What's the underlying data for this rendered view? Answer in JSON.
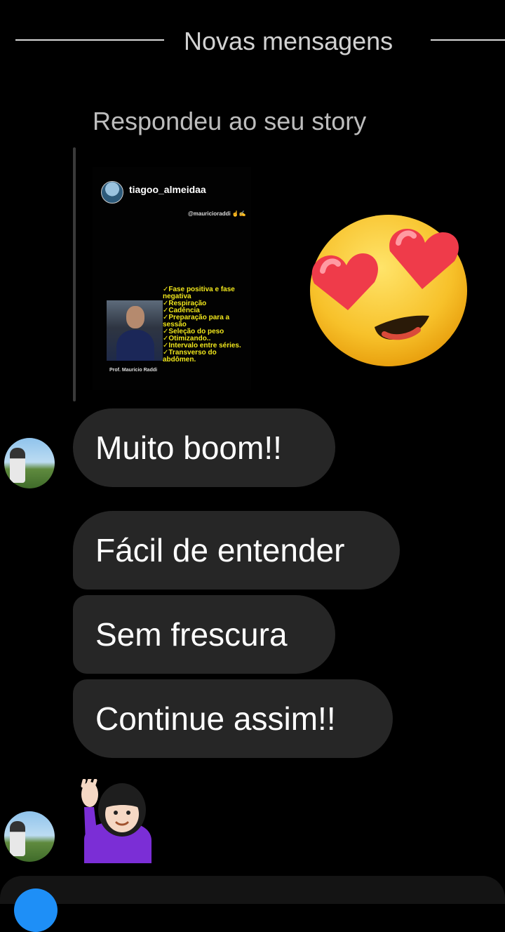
{
  "divider": {
    "label": "Novas mensagens"
  },
  "reply": {
    "note": "Respondeu ao seu story"
  },
  "story": {
    "username": "tiagoo_almeidaa",
    "mention": "@mauricioraddi ☝️✍️",
    "checklist": [
      "✓Fase positiva e fase negativa",
      "✓Respiração",
      "✓Cadência",
      "✓Preparação para a sessão",
      "✓Seleção do peso",
      "✓Otimizando..",
      "✓Intervalo entre séries.",
      "✓Transverso do abdômen."
    ],
    "caption": "Prof. Mauricio Raddi",
    "text_color": "#f2e81c"
  },
  "reaction": {
    "icon": "heart-eyes-emoji-icon"
  },
  "messages": [
    {
      "text": "Muito boom!!"
    },
    {
      "text": "Fácil de entender"
    },
    {
      "text": "Sem frescura"
    },
    {
      "text": "Continue assim!!"
    }
  ],
  "last_reaction": {
    "icon": "woman-raising-hand-emoji-icon"
  },
  "colors": {
    "bubble": "#262626",
    "background": "#000000",
    "camera_button": "#1e8ff7"
  }
}
